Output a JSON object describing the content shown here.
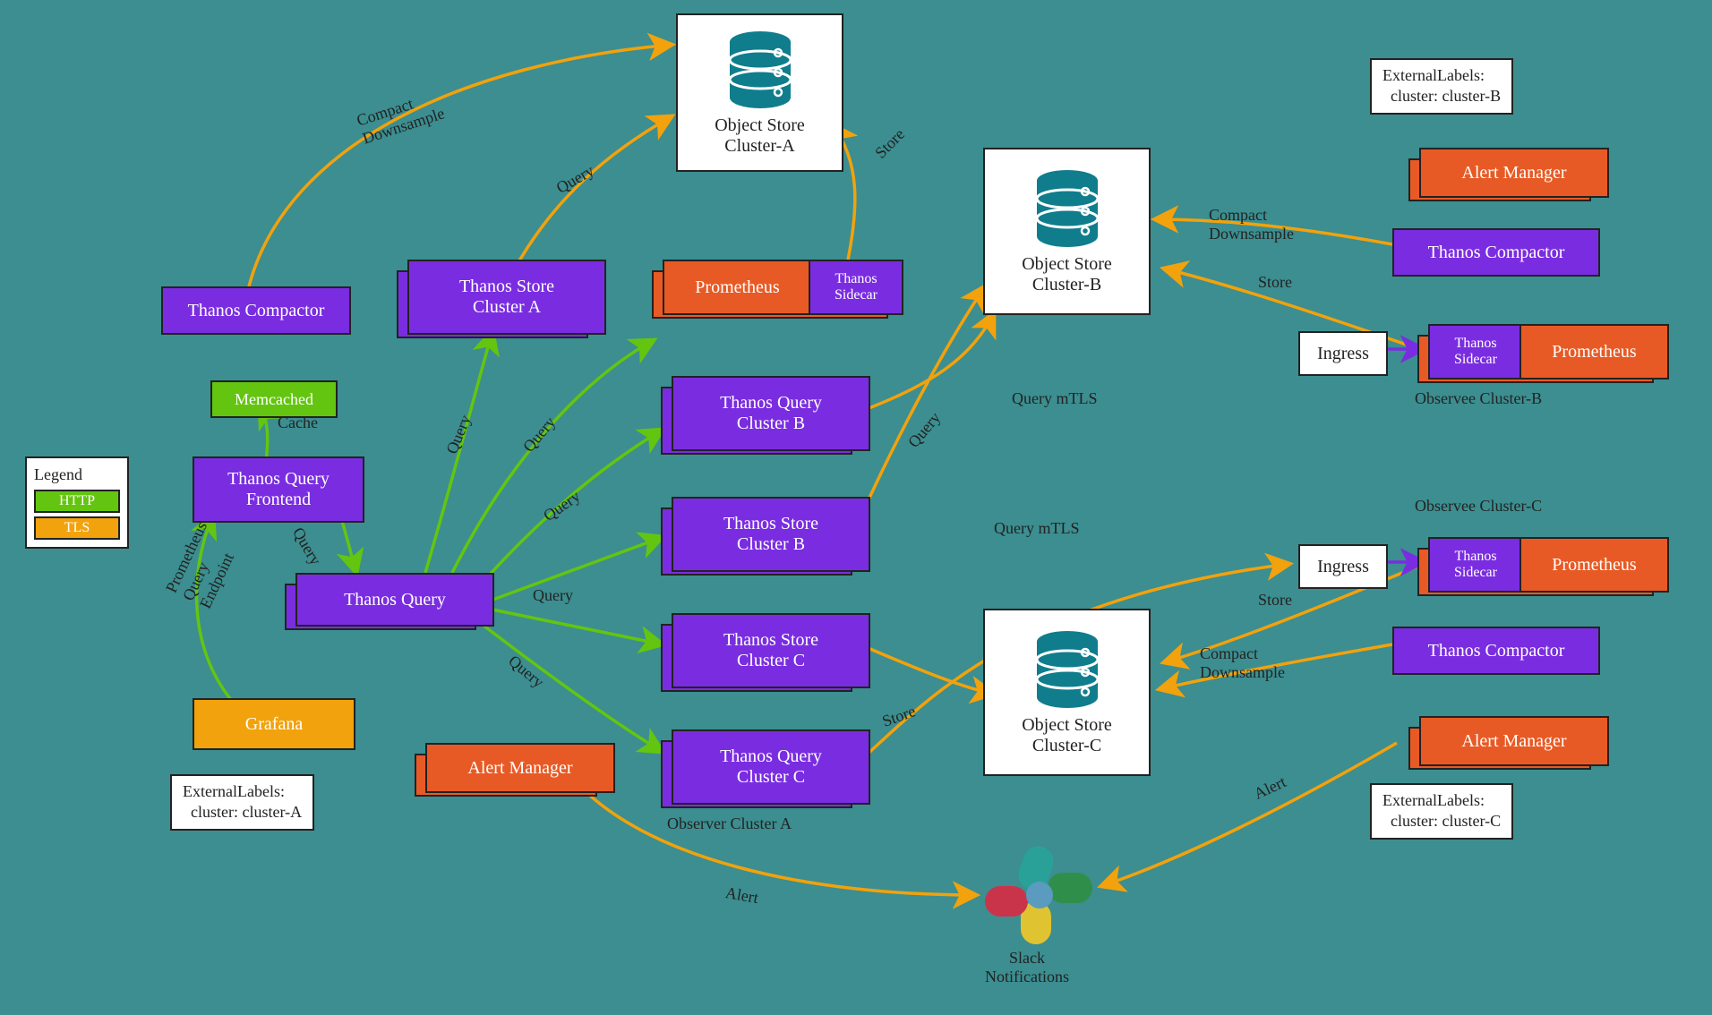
{
  "legend": {
    "title": "Legend",
    "http": "HTTP",
    "tls": "TLS"
  },
  "colors": {
    "http": "#63c510",
    "tls": "#f2a20c",
    "purple": "#7a2de0",
    "orange": "#e85a25",
    "white": "#ffffff",
    "teal": "#0f7d8c"
  },
  "nodes": {
    "thanos_compactor_a": "Thanos Compactor",
    "thanos_store_a": "Thanos Store\nCluster A",
    "prometheus_a": "Prometheus",
    "sidecar_a": "Thanos\nSidecar",
    "memcached": "Memcached",
    "thanos_query_frontend": "Thanos Query\nFrontend",
    "thanos_query": "Thanos Query",
    "grafana": "Grafana",
    "alert_manager_a": "Alert Manager",
    "thanos_query_b": "Thanos Query\nCluster B",
    "thanos_store_b": "Thanos Store\nCluster B",
    "thanos_store_c": "Thanos Store\nCluster C",
    "thanos_query_c": "Thanos Query\nCluster C",
    "ingress_b": "Ingress",
    "ingress_c": "Ingress",
    "sidecar_b": "Thanos\nSidecar",
    "prometheus_b": "Prometheus",
    "sidecar_c": "Thanos\nSidecar",
    "prometheus_c": "Prometheus",
    "thanos_compactor_b": "Thanos Compactor",
    "thanos_compactor_c": "Thanos Compactor",
    "alert_manager_b": "Alert Manager",
    "alert_manager_c": "Alert Manager",
    "object_store_a": "Object Store\nCluster-A",
    "object_store_b": "Object Store\nCluster-B",
    "object_store_c": "Object Store\nCluster-C",
    "slack": "Slack\nNotifications",
    "observer_a": "Observer Cluster A",
    "observee_b": "Observee Cluster-B",
    "observee_c": "Observee Cluster-C"
  },
  "notes": {
    "labels_a": "ExternalLabels:\n  cluster: cluster-A",
    "labels_b": "ExternalLabels:\n  cluster: cluster-B",
    "labels_c": "ExternalLabels:\n  cluster: cluster-C"
  },
  "edge_labels": {
    "compact_downsample": "Compact\nDownsample",
    "query": "Query",
    "store": "Store",
    "cache": "Cache",
    "prom_endpoint": "Prometheus\nQuery\nEndpoint",
    "query_mtls": "Query mTLS",
    "alert": "Alert"
  }
}
